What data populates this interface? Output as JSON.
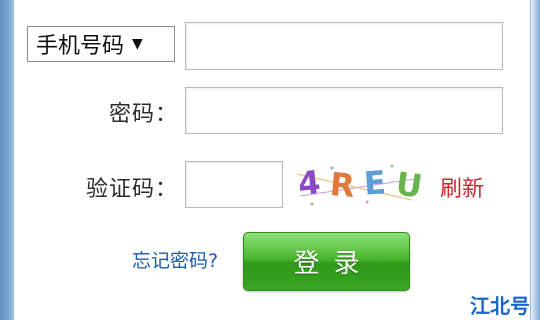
{
  "account_type": {
    "selected": "手机号码",
    "arrow": "▼"
  },
  "password": {
    "label": "密码："
  },
  "captcha": {
    "label": "验证码：",
    "image_text": "4REU",
    "chars": [
      "4",
      "R",
      "E",
      "U"
    ],
    "refresh_label": "刷新"
  },
  "links": {
    "forgot_password": "忘记密码?"
  },
  "buttons": {
    "login": "登录"
  },
  "watermark": "江北号",
  "colors": {
    "login_green": "#3aa622",
    "refresh_red": "#d0262c",
    "link_blue": "#1f5ba8",
    "watermark_blue": "#1766c8"
  }
}
